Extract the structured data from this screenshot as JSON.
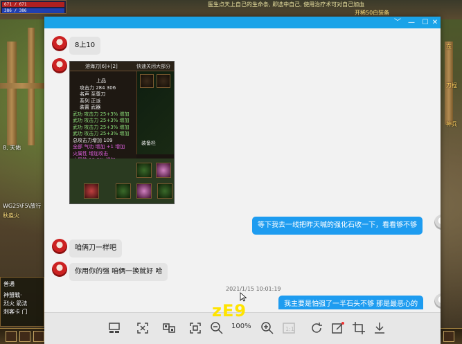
{
  "game": {
    "hp_text": "671 / 671",
    "mp_text": "386 / 386",
    "top_message": "医生点天上自己的生命条, 即选中自己, 使用治疗术可对自己加血",
    "top_right_text": "开稀50白装备",
    "top_right_dir": "北",
    "left_label_1": "8, 天佑",
    "left_label_2": "WG25\\F5\\放行",
    "left_label_3": "秋淼火",
    "left_panel_lines": [
      "普通",
      "神盟戰·",
      "烈火 箭法",
      "刺客卡 门"
    ],
    "right_labels": [
      "东",
      "刀棍",
      "神兵"
    ]
  },
  "window": {
    "minimize": "﹀",
    "restore": "—",
    "maximize": "☐",
    "close": "✕"
  },
  "chat": {
    "messages": [
      {
        "side": "left",
        "text": "8上10"
      },
      {
        "side": "right",
        "text": "等下我去一线把昨天喊的强化石收一下，看看够不够"
      },
      {
        "side": "left",
        "text": "咱俩刀一样吧"
      },
      {
        "side": "left",
        "text": "你用你的强 咱俩一换就好 哈"
      },
      {
        "side": "right",
        "text": "我主要是怕强了一半石头不够 那是最恶心的"
      }
    ],
    "timestamp": "2021/1/15 10:01:19"
  },
  "game_screenshot": {
    "title": "溶海刀[6]+[2]",
    "title_right": "快速关闭大部分",
    "lines": [
      {
        "cls": "w",
        "text": "上品"
      },
      {
        "cls": "w",
        "text": "攻击力  284  306"
      },
      {
        "cls": "w",
        "text": "名声  至尊刀"
      },
      {
        "cls": "w",
        "text": "系列  正派"
      },
      {
        "cls": "w",
        "text": "装置  武器"
      },
      {
        "cls": "g",
        "text": "武功 攻击力 25+3% 增加"
      },
      {
        "cls": "g",
        "text": "武功 攻击力 25+3% 增加"
      },
      {
        "cls": "g",
        "text": "武功 攻击力 25+3% 增加"
      },
      {
        "cls": "g",
        "text": "武功 攻击力 25+3% 增加"
      },
      {
        "cls": "w",
        "text": "总攻击力增加 109"
      },
      {
        "cls": "p",
        "text": "全部 气功 增加 +1 增加"
      },
      {
        "cls": "p",
        "text": "火属性 增加攻击"
      },
      {
        "cls": "p",
        "text": "火属性 13.3% 增加"
      }
    ],
    "side_label": "装备栏"
  },
  "toolbar": {
    "zoom_value": "100%",
    "icons": [
      "gallery-icon",
      "fit-screen-icon",
      "compare-icon",
      "actual-size-icon",
      "zoom-out-icon",
      "zoom-in-icon",
      "one-to-one-icon",
      "rotate-icon",
      "edit-icon",
      "crop-icon",
      "download-icon"
    ]
  },
  "overlay_watermark": "zE9",
  "colors": {
    "titlebar": "#1aa3e8",
    "bubble_blue": "#1e9cf0",
    "bubble_gray": "#e4e4e4",
    "watermark": "#ffe400"
  }
}
